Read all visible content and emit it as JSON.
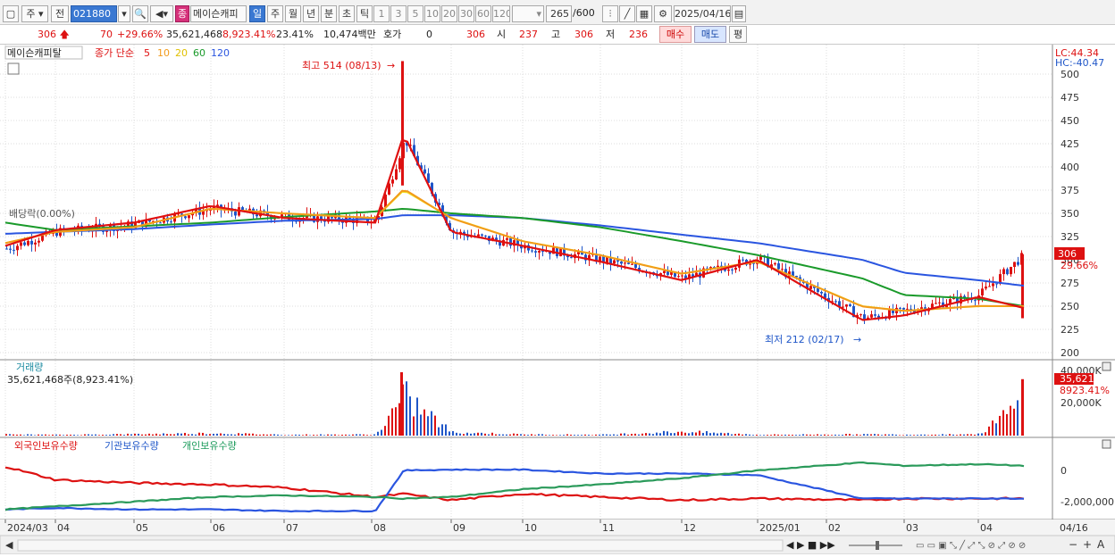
{
  "toolbar": {
    "period": "주",
    "prev": "전",
    "code": "021880",
    "name": "메이슨캐피",
    "name_badge": "종",
    "tabs": [
      "일",
      "주",
      "월",
      "년",
      "분",
      "초",
      "틱"
    ],
    "active_tab": "일",
    "counts": [
      "1",
      "3",
      "5",
      "10",
      "20",
      "30",
      "60",
      "120"
    ],
    "range": "265",
    "range_total": "/600",
    "date": "2025/04/16"
  },
  "quote": {
    "price": "306",
    "change": "70",
    "change_pct": "+29.66%",
    "volume": "35,621,468",
    "volume_pct": "8,923.41%",
    "turnover": "23.41%",
    "amount": "10,474백만",
    "ask_label": "호가",
    "ask_val": "0",
    "bid_val": "306",
    "open_label": "시",
    "open": "237",
    "high_label": "고",
    "high": "306",
    "low_label": "저",
    "low": "236",
    "buy": "매수",
    "sell": "매도",
    "avg": "평"
  },
  "price_panel": {
    "name": "메이슨캐피탈",
    "ma_label": "종가 단순",
    "ma_periods": [
      "5",
      "10",
      "20",
      "60",
      "120"
    ],
    "ma_colors": [
      "#e01010",
      "#f29a1a",
      "#f0e020",
      "#1a9a2a",
      "#2a55e0"
    ],
    "lc": "LC:44.34",
    "hc": "HC:-40.47",
    "y_ticks": [
      "500",
      "475",
      "450",
      "425",
      "400",
      "375",
      "350",
      "325",
      "300",
      "275",
      "250",
      "225",
      "200"
    ],
    "high_note": "최고 514 (08/13)",
    "low_note": "최저 212 (02/17)",
    "dividend": "배당락(0.00%)",
    "last_price": "306",
    "last_pct": "29.66%"
  },
  "volume_panel": {
    "title": "거래량",
    "value": "35,621,468주(8,923.41%)",
    "y_ticks": [
      "40,000K",
      "20,000K"
    ],
    "last": "35,621K",
    "last_pct": "8923.41%"
  },
  "holdings_panel": {
    "labels": [
      "외국인보유수량",
      "기관보유수량",
      "개인보유수량"
    ],
    "y_ticks": [
      "0",
      "-2,000,000"
    ]
  },
  "x_axis": [
    "2024/03",
    "04",
    "05",
    "06",
    "07",
    "08",
    "09",
    "10",
    "11",
    "12",
    "2025/01",
    "02",
    "03",
    "04"
  ],
  "x_right": "04/16",
  "chart_data": [
    {
      "type": "candlestick",
      "title": "메이슨캐피탈",
      "ylim": [
        200,
        514
      ],
      "x": [
        "2024/03",
        "2024/04",
        "2024/05",
        "2024/06",
        "2024/07",
        "2024/08",
        "2024/08/13",
        "2024/09",
        "2024/10",
        "2024/11",
        "2024/12",
        "2025/01",
        "2025/02/17",
        "2025/03",
        "2025/04",
        "2025/04/16"
      ],
      "series": [
        {
          "name": "종가",
          "values": [
            312,
            330,
            338,
            355,
            346,
            342,
            430,
            330,
            315,
            300,
            280,
            302,
            237,
            245,
            262,
            306
          ]
        },
        {
          "name": "5",
          "values": [
            315,
            332,
            340,
            358,
            345,
            340,
            435,
            330,
            315,
            298,
            278,
            300,
            235,
            240,
            260,
            248
          ]
        },
        {
          "name": "20",
          "values": [
            318,
            330,
            335,
            355,
            350,
            345,
            375,
            345,
            320,
            305,
            285,
            298,
            250,
            245,
            250,
            250
          ]
        },
        {
          "name": "60",
          "values": [
            340,
            332,
            336,
            340,
            346,
            352,
            355,
            350,
            345,
            335,
            320,
            305,
            280,
            262,
            258,
            250
          ]
        },
        {
          "name": "120",
          "values": [
            328,
            330,
            333,
            338,
            342,
            344,
            348,
            348,
            345,
            337,
            327,
            318,
            300,
            286,
            278,
            272
          ]
        }
      ]
    },
    {
      "type": "bar",
      "title": "거래량",
      "values_k": [
        1200,
        800,
        1500,
        2500,
        900,
        1100,
        40000,
        3500,
        1200,
        900,
        4200,
        900,
        1300,
        1000,
        1500,
        35621
      ]
    },
    {
      "type": "line",
      "title": "보유수량",
      "series": [
        {
          "name": "외국인보유수량",
          "values": [
            250000,
            -600000,
            -800000,
            -900000,
            -1100000,
            -1700000,
            -1500000,
            -1900000,
            -1500000,
            -1700000,
            -1900000,
            -1800000,
            -1900000,
            -1800000,
            -1800000,
            -1800000
          ]
        },
        {
          "name": "기관보유수량",
          "values": [
            -2500000,
            -2400000,
            -2500000,
            -2500000,
            -2600000,
            -2600000,
            0,
            50000,
            50000,
            -200000,
            -200000,
            -300000,
            -1800000,
            -1800000,
            -1800000,
            -1800000
          ]
        },
        {
          "name": "개인보유수량",
          "values": [
            -2500000,
            -2300000,
            -2000000,
            -1700000,
            -1600000,
            -1700000,
            -1800000,
            -1700000,
            -1200000,
            -900000,
            -500000,
            0,
            500000,
            300000,
            400000,
            300000
          ]
        }
      ]
    }
  ],
  "bottom": {
    "tools": "◀ ▶ ■ ▶▶"
  }
}
